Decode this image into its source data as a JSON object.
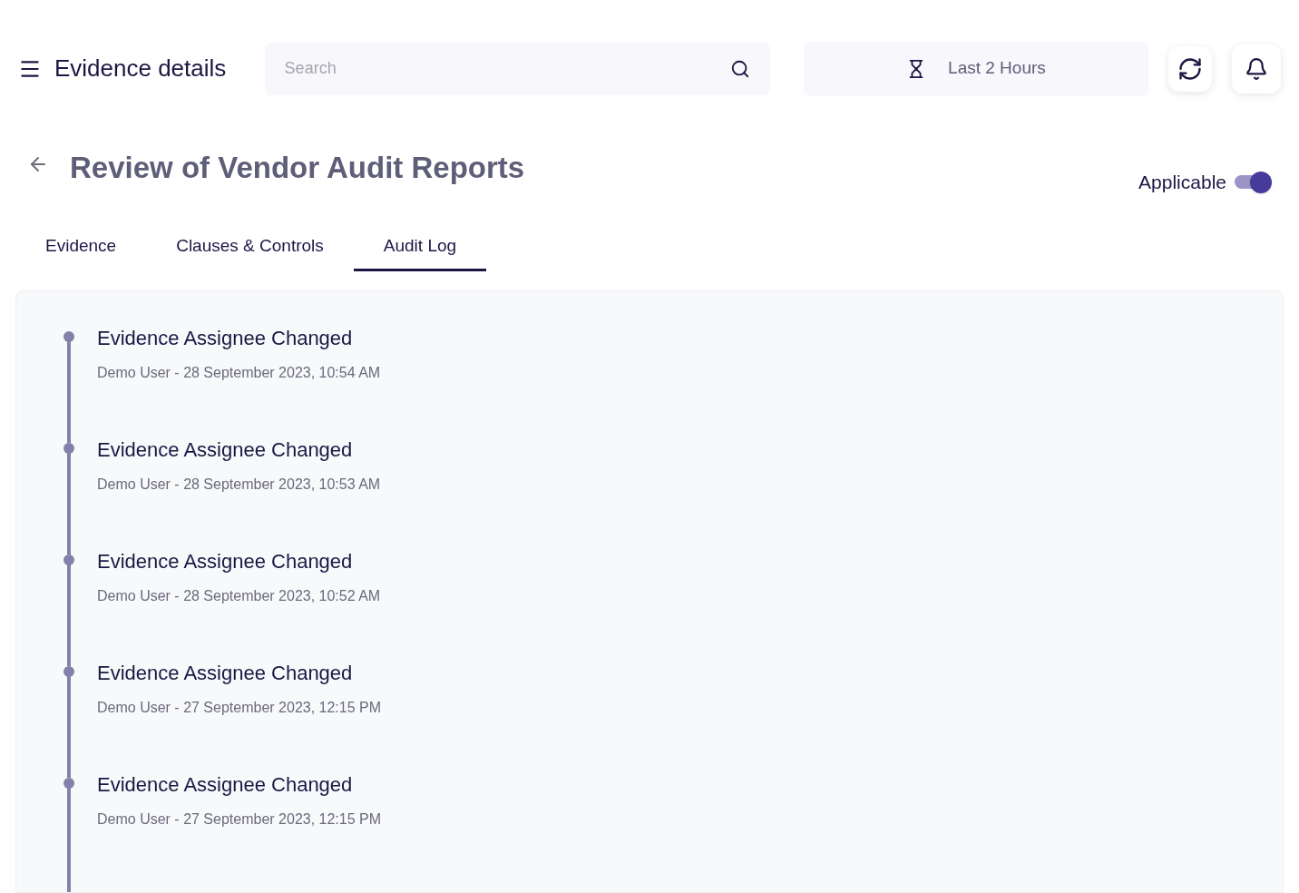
{
  "header": {
    "title": "Evidence details",
    "search": {
      "placeholder": "Search"
    },
    "time_range": "Last 2 Hours"
  },
  "page": {
    "title": "Review of Vendor Audit Reports",
    "applicable": {
      "label": "Applicable",
      "on": true
    }
  },
  "tabs": [
    {
      "label": "Evidence",
      "selected": false
    },
    {
      "label": "Clauses & Controls",
      "selected": false
    },
    {
      "label": "Audit Log",
      "selected": true
    }
  ],
  "audit_log": [
    {
      "title": "Evidence Assignee Changed",
      "meta": "Demo User - 28 September 2023, 10:54 AM"
    },
    {
      "title": "Evidence Assignee Changed",
      "meta": "Demo User - 28 September 2023, 10:53 AM"
    },
    {
      "title": "Evidence Assignee Changed",
      "meta": "Demo User - 28 September 2023, 10:52 AM"
    },
    {
      "title": "Evidence Assignee Changed",
      "meta": "Demo User - 27 September 2023, 12:15 PM"
    },
    {
      "title": "Evidence Assignee Changed",
      "meta": "Demo User - 27 September 2023, 12:15 PM"
    }
  ]
}
